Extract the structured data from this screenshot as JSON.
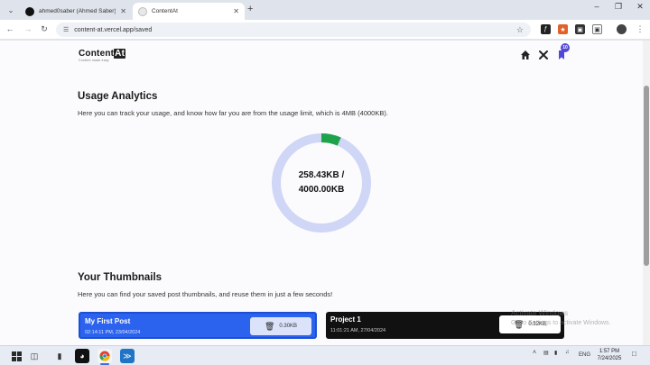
{
  "browser": {
    "tabs": [
      {
        "label": "ahmed0saber (Ahmed Saber)",
        "active": false
      },
      {
        "label": "ContentAt",
        "active": true
      }
    ],
    "url": "content-at.vercel.app/saved"
  },
  "header": {
    "brand": "Content",
    "brand_highlight": "At",
    "tagline": "Content made easy",
    "saved_count": "10"
  },
  "analytics": {
    "title": "Usage Analytics",
    "description": "Here you can track your usage, and know how far you are from the usage limit, which is 4MB (4000KB).",
    "used": "258.43KB /",
    "limit": "4000.00KB",
    "usage_fraction": 0.0646,
    "colors": {
      "track": "#cfd6f6",
      "fill": "#1fa34a"
    }
  },
  "thumbnails": {
    "title": "Your Thumbnails",
    "description": "Here you can find your saved post thumbnails, and reuse them in just a few seconds!",
    "cards": [
      {
        "title": "My First Post",
        "date": "02:14:11 PM, 23/04/2024",
        "size": "0.30KB"
      },
      {
        "title": "Project 1",
        "date": "11:01:21 AM, 27/04/2024",
        "size": "0.32KB"
      }
    ]
  },
  "watermark": {
    "line1": "Activate Windows",
    "line2": "Go to Settings to activate Windows."
  },
  "taskbar": {
    "language": "ENG",
    "time": "1:57 PM",
    "date": "7/24/2025"
  }
}
